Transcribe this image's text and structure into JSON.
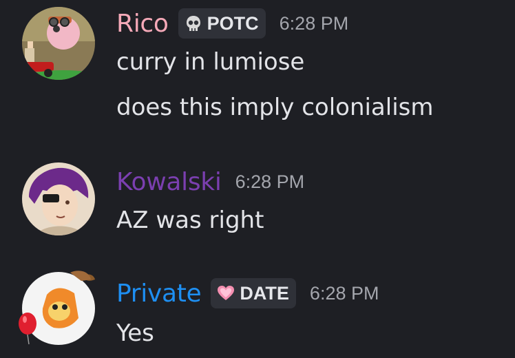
{
  "colors": {
    "background": "#1e1f24",
    "rico_name": "#f5a9b8",
    "kowalski_name": "#7b3fb0",
    "private_name": "#1e8ff2",
    "timestamp": "#a4a6ad",
    "tag_bg": "#2f3138",
    "message_text": "#e3e4e8"
  },
  "messages": [
    {
      "author": "Rico",
      "avatar_icon": "rico-avatar-icon",
      "tag": {
        "icon": "skull-icon",
        "label": "POTC"
      },
      "time": "6:28 PM",
      "lines": [
        "curry in lumiose",
        "does this imply colonialism"
      ]
    },
    {
      "author": "Kowalski",
      "avatar_icon": "kowalski-avatar-icon",
      "time": "6:28 PM",
      "lines": [
        "AZ was right"
      ]
    },
    {
      "author": "Private",
      "avatar_icon": "private-avatar-icon",
      "tag": {
        "icon": "pink-heart-icon",
        "label": "DATE"
      },
      "time": "6:28 PM",
      "lines": [
        "Yes"
      ]
    }
  ]
}
